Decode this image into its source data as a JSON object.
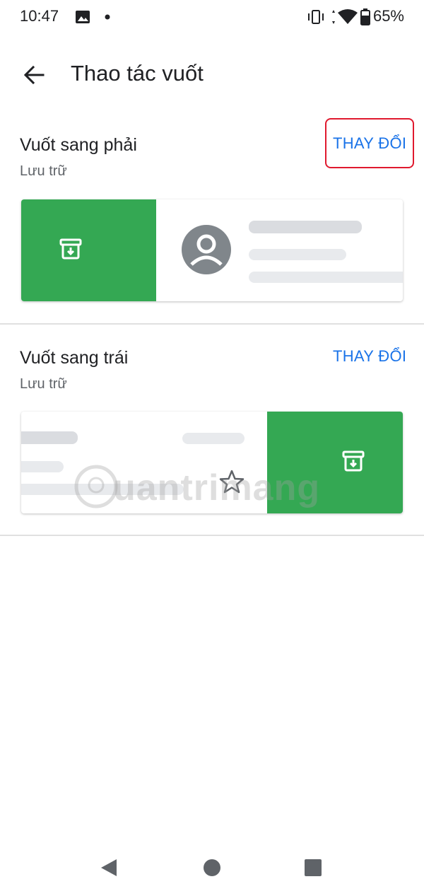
{
  "status_bar": {
    "time": "10:47",
    "battery_percent": "65%",
    "icons": [
      "image-icon",
      "dot-icon",
      "vibrate-icon",
      "wifi-icon",
      "battery-icon"
    ]
  },
  "app_bar": {
    "title": "Thao tác vuốt",
    "back_icon": "arrow-back-icon"
  },
  "sections": [
    {
      "title": "Vuốt sang phải",
      "subtitle": "Lưu trữ",
      "change_label": "THAY ĐỔI",
      "action_icon": "archive-icon"
    },
    {
      "title": "Vuốt sang trái",
      "subtitle": "Lưu trữ",
      "change_label": "THAY ĐỔI",
      "action_icon": "archive-icon"
    }
  ],
  "watermark": "uantrimang",
  "colors": {
    "accent": "#1a73e8",
    "swipe_green": "#34a853",
    "highlight_red": "#e0192e"
  },
  "nav_bar": {
    "icons": [
      "nav-back-icon",
      "nav-home-icon",
      "nav-recents-icon"
    ]
  }
}
